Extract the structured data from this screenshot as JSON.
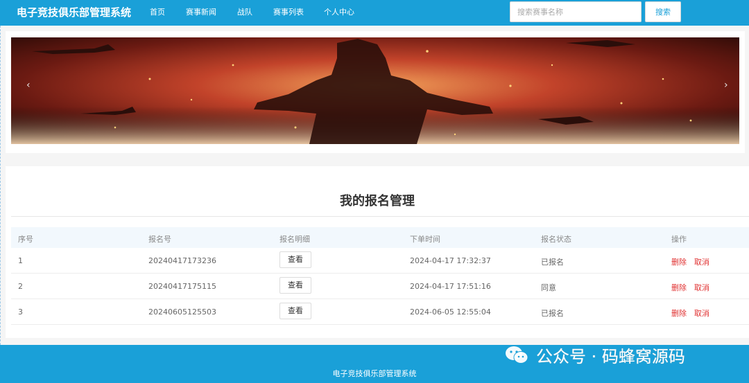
{
  "app": {
    "title": "电子竞技俱乐部管理系统"
  },
  "nav": {
    "items": [
      {
        "label": "首页"
      },
      {
        "label": "赛事新闻"
      },
      {
        "label": "战队"
      },
      {
        "label": "赛事列表"
      },
      {
        "label": "个人中心"
      }
    ]
  },
  "search": {
    "placeholder": "搜索赛事名称",
    "value": "",
    "button_label": "搜索"
  },
  "carousel": {
    "prev_glyph": "‹",
    "next_glyph": "›",
    "icons": [
      "chevron-left-icon",
      "chevron-right-icon"
    ]
  },
  "main": {
    "heading": "我的报名管理",
    "table": {
      "columns": [
        "序号",
        "报名号",
        "报名明细",
        "下单时间",
        "报名状态",
        "操作"
      ],
      "rows": [
        {
          "index": "1",
          "number": "20240417173236",
          "detail_button": "查看",
          "time": "2024-04-17 17:32:37",
          "status": "已报名",
          "delete": "删除",
          "cancel": "取消"
        },
        {
          "index": "2",
          "number": "20240417175115",
          "detail_button": "查看",
          "time": "2024-04-17 17:51:16",
          "status": "同意",
          "delete": "删除",
          "cancel": "取消"
        },
        {
          "index": "3",
          "number": "20240605125503",
          "detail_button": "查看",
          "time": "2024-06-05 12:55:04",
          "status": "已报名",
          "delete": "删除",
          "cancel": "取消"
        }
      ]
    }
  },
  "footer": {
    "text": "电子竞技俱乐部管理系统"
  },
  "watermark": {
    "text": "公众号 · 码蜂窝源码",
    "icon": "wechat-icon"
  },
  "colors": {
    "primary": "#1aa0d8",
    "danger": "#e03131",
    "header_row": "#f2f8fd"
  }
}
